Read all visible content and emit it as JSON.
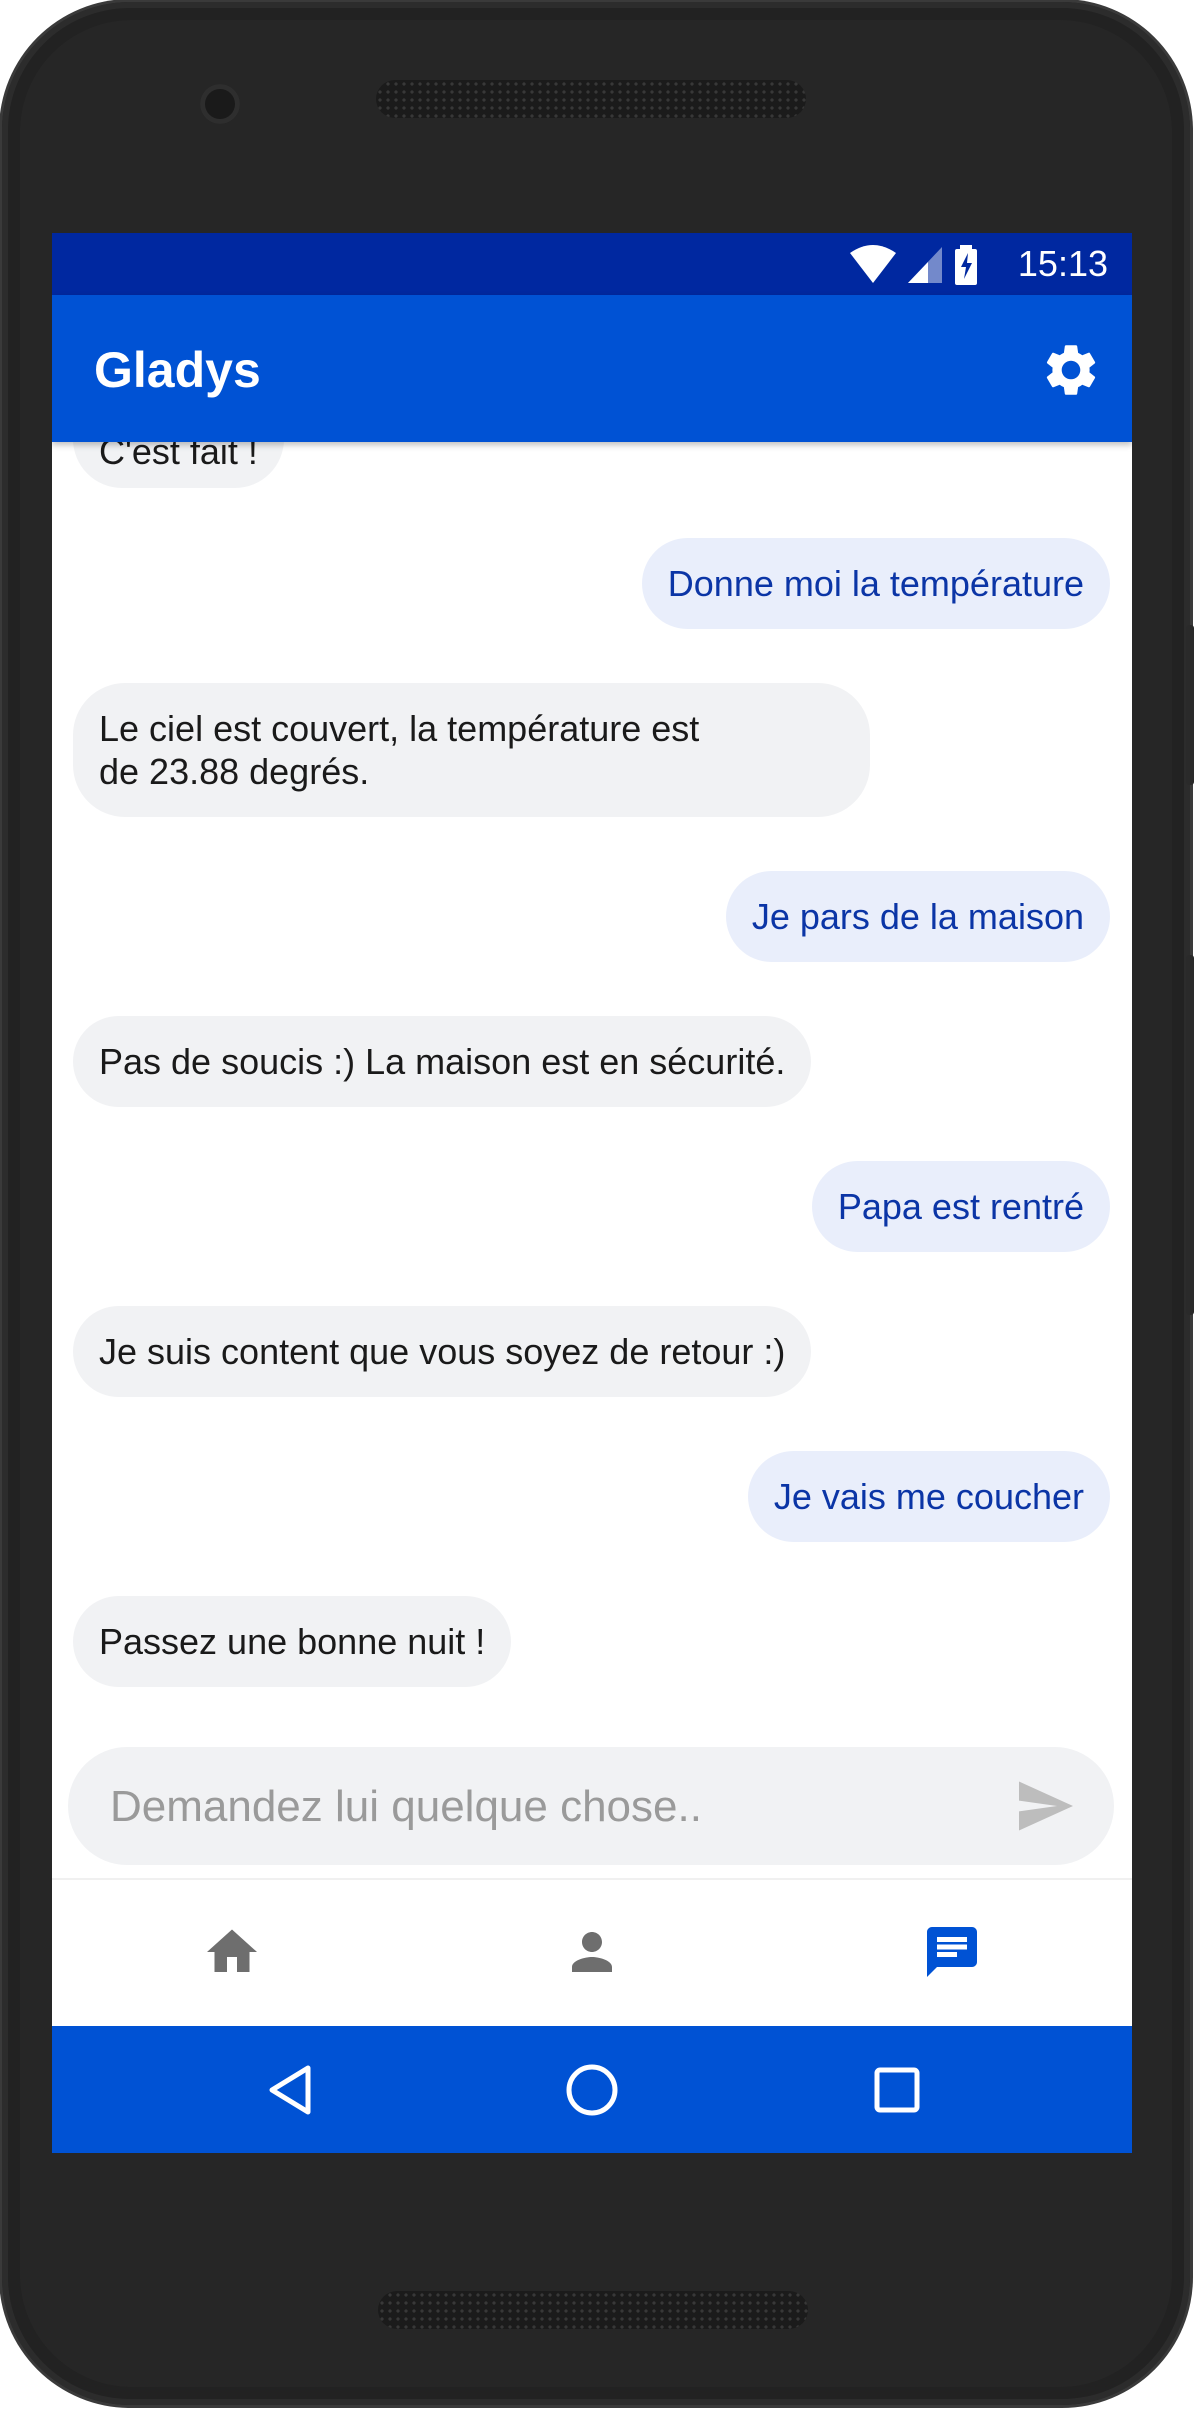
{
  "status_bar": {
    "time": "15:13"
  },
  "app_bar": {
    "title": "Gladys"
  },
  "messages": [
    {
      "from": "bot",
      "text": "C'est fait !"
    },
    {
      "from": "user",
      "text": "Donne moi la température"
    },
    {
      "from": "bot",
      "text": "Le ciel est couvert, la température est\nde 23.88 degrés."
    },
    {
      "from": "user",
      "text": "Je pars de la maison"
    },
    {
      "from": "bot",
      "text": "Pas de soucis :) La maison est en sécurité."
    },
    {
      "from": "user",
      "text": "Papa est rentré"
    },
    {
      "from": "bot",
      "text": "Je suis content que vous soyez de retour :)"
    },
    {
      "from": "user",
      "text": "Je vais me coucher"
    },
    {
      "from": "bot",
      "text": "Passez une bonne nuit !"
    }
  ],
  "input": {
    "placeholder": "Demandez lui quelque chose..",
    "value": ""
  },
  "bottom_nav": {
    "items": [
      {
        "icon": "home-icon",
        "active": false
      },
      {
        "icon": "person-icon",
        "active": false
      },
      {
        "icon": "chat-icon",
        "active": true
      }
    ]
  },
  "colors": {
    "status_bar": "#0028a0",
    "primary": "#0052d4",
    "bot_bubble": "#f1f2f4",
    "user_bubble": "#e9eefb",
    "user_text": "#0b35a6",
    "inactive_icon": "#6e6e6e"
  }
}
